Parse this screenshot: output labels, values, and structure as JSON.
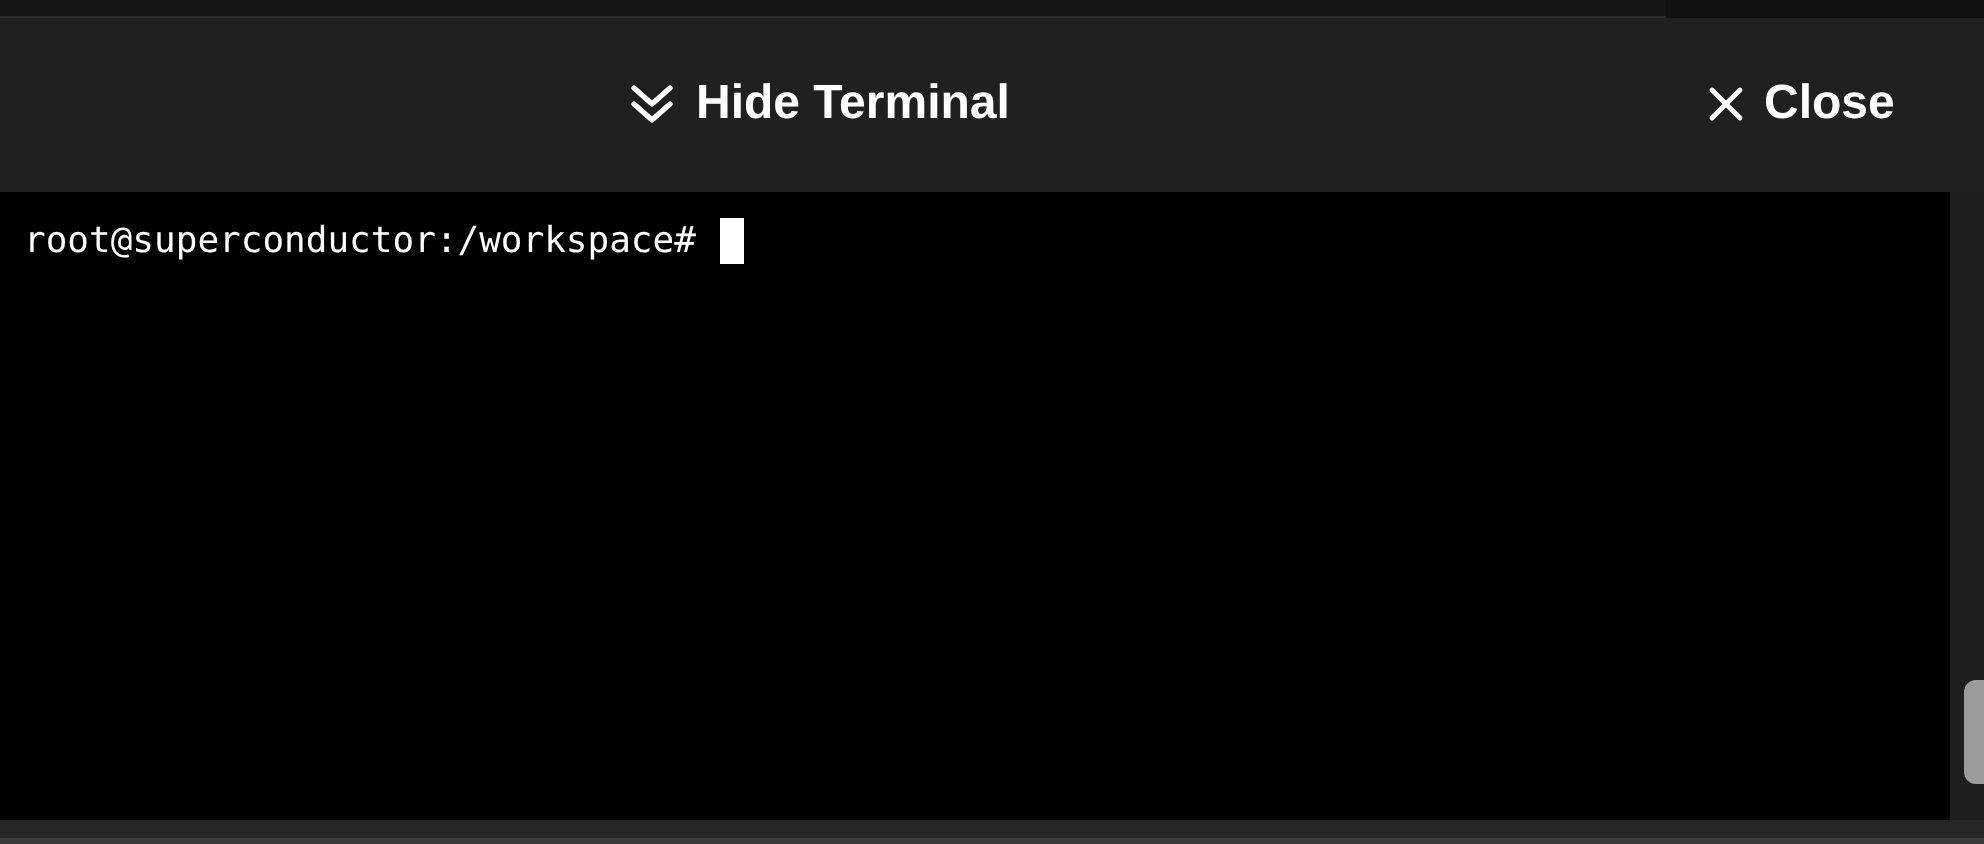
{
  "header": {
    "hide_button": {
      "label": "Hide Terminal"
    },
    "close_button": {
      "label": "Close"
    }
  },
  "terminal": {
    "prompt": "root@superconductor:/workspace#"
  }
}
